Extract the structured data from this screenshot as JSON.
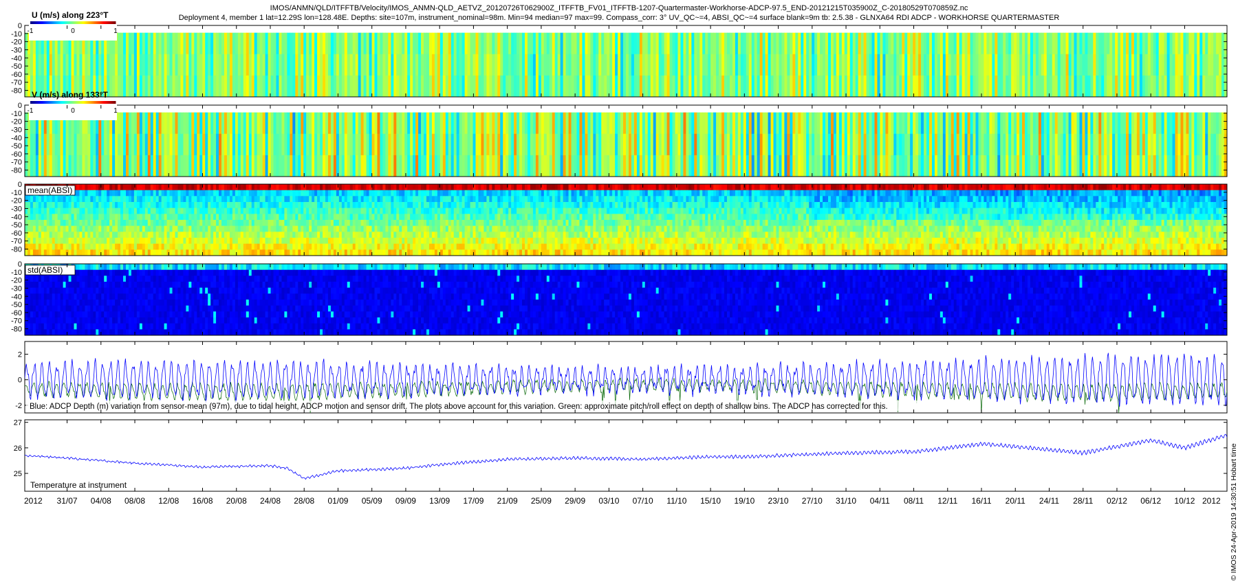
{
  "header": {
    "line1": "IMOS/ANMN/QLD/ITFFTB/Velocity/IMOS_ANMN-QLD_AETVZ_20120726T062900Z_ITFFTB_FV01_ITFFTB-1207-Quartermaster-Workhorse-ADCP-97.5_END-20121215T035900Z_C-20180529T070859Z.nc",
    "line2": "Deployment 4, member 1 lat=12.29S lon=128.48E. Depths: site=107m, instrument_nominal=98m. Min=94 median=97 max=99. Compass_corr: 3° UV_QC~=4, ABSI_QC~=4 surface blank=9m tb: 2.5.38 - GLNXA64 RDI ADCP - WORKHORSE QUARTERMASTER"
  },
  "side_label": "© IMOS 24-Apr-2019 14:30:51 Hobart time",
  "colors": {
    "depth_line": "#0000ff",
    "pitch_line": "#006400",
    "temp_line": "#0000ff"
  },
  "chart_data": [
    {
      "type": "heatmap",
      "label": "U (m/s) along 223°T",
      "colorbar": {
        "ticks": [
          "-1",
          "0",
          "1"
        ],
        "range": [
          -1,
          1
        ]
      },
      "y_ticks": [
        "0",
        "-10",
        "-20",
        "-30",
        "-40",
        "-50",
        "-60",
        "-70",
        "-80"
      ],
      "ylim": [
        -88,
        0
      ],
      "data_top_depth": -9,
      "description_level": "mostly near 0 (green), alternating vertical bands"
    },
    {
      "type": "heatmap",
      "label": "V (m/s) along 133°T",
      "colorbar": {
        "ticks": [
          "-1",
          "0",
          "1"
        ],
        "range": [
          -1,
          1
        ]
      },
      "y_ticks": [
        "0",
        "-10",
        "-20",
        "-30",
        "-40",
        "-50",
        "-60",
        "-70",
        "-80"
      ],
      "ylim": [
        -88,
        0
      ],
      "data_top_depth": -9
    },
    {
      "type": "heatmap",
      "label": "mean(ABSI)",
      "y_ticks": [
        "0",
        "-10",
        "-20",
        "-30",
        "-40",
        "-50",
        "-60",
        "-70",
        "-80"
      ],
      "ylim": [
        -88,
        0
      ]
    },
    {
      "type": "heatmap",
      "label": "std(ABSI)",
      "y_ticks": [
        "0",
        "-10",
        "-20",
        "-30",
        "-40",
        "-50",
        "-60",
        "-70",
        "-80"
      ],
      "ylim": [
        -88,
        0
      ]
    },
    {
      "type": "line",
      "y_ticks": [
        "2",
        "0",
        "-2"
      ],
      "ylim": [
        -2.6,
        3.0
      ],
      "annotation": "Blue: ADCP Depth (m) variation from sensor-mean (97m), due to tidal height, ADCP motion and sensor drift. The plots above account for this variation. Green: approximate pitch/roll effect on depth of shallow bins. The ADCP has corrected for this."
    },
    {
      "type": "line",
      "label": "Temperature at instrument",
      "y_ticks": [
        "27",
        "26",
        "25"
      ],
      "ylim": [
        24.3,
        27.1
      ],
      "x_ticks": [
        "31/07",
        "04/08",
        "08/08",
        "12/08",
        "16/08",
        "20/08",
        "24/08",
        "28/08",
        "01/09",
        "05/09",
        "09/09",
        "13/09",
        "17/09",
        "21/09",
        "25/09",
        "29/09",
        "03/10",
        "07/10",
        "11/10",
        "15/10",
        "19/10",
        "23/10",
        "27/10",
        "31/10",
        "04/11",
        "08/11",
        "12/11",
        "16/11",
        "20/11",
        "24/11",
        "28/11",
        "02/12",
        "06/12",
        "10/12"
      ],
      "x_start_label": "2012",
      "x_end_label": "2012",
      "series": [
        {
          "x": [
            "26/07",
            "31/07",
            "08/08",
            "16/08",
            "24/08",
            "26/08",
            "28/08",
            "01/09",
            "09/09",
            "13/09",
            "21/09",
            "29/09",
            "07/10",
            "15/10",
            "19/10",
            "31/10",
            "08/11",
            "16/11",
            "20/11",
            "28/11",
            "06/12",
            "10/12",
            "15/12"
          ],
          "values": [
            25.7,
            25.6,
            25.4,
            25.25,
            25.3,
            25.2,
            24.8,
            25.1,
            25.2,
            25.35,
            25.55,
            25.6,
            25.55,
            25.65,
            25.65,
            25.8,
            25.85,
            26.15,
            26.05,
            25.8,
            26.3,
            26.0,
            26.5
          ]
        }
      ]
    }
  ]
}
